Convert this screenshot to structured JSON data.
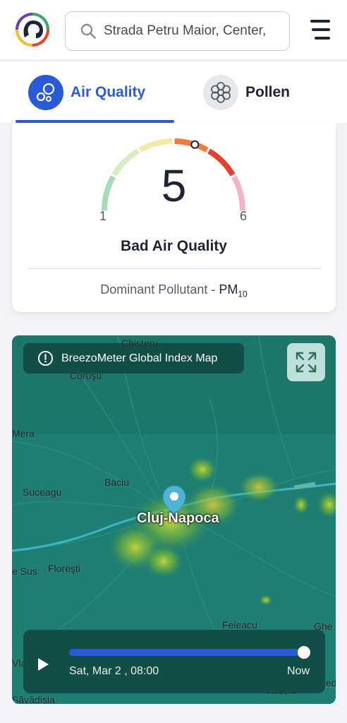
{
  "header": {
    "logo_icon": "breezometer-logo-icon",
    "search": {
      "value": "Strada Petru Maior, Center,",
      "icon": "search-icon"
    },
    "menu_icon": "hamburger-menu-icon"
  },
  "tabs": [
    {
      "label": "Air Quality",
      "icon": "air-bubbles-icon",
      "active": true
    },
    {
      "label": "Pollen",
      "icon": "pollen-flower-icon",
      "active": false
    }
  ],
  "air_quality": {
    "value": "5",
    "scale_min": "1",
    "scale_max": "6",
    "level": 5,
    "label": "Bad Air Quality",
    "dominant_pollutant_prefix": "Dominant Pollutant - ",
    "pollutant_main": "PM",
    "pollutant_sub": "10",
    "colors": [
      "#a8dcb9",
      "#d8ecc2",
      "#f8e9a8",
      "#f07b3e",
      "#e73f2c",
      "#f5b3c7"
    ]
  },
  "map": {
    "title": "BreezoMeter Global Index Map",
    "info_icon": "info-circle-icon",
    "expand_icon": "expand-arrows-icon",
    "city": "Cluj-Napoca",
    "places": [
      "Chisteru",
      "Coruşu",
      "Mera",
      "Baciu",
      "Suceagu",
      "e Sus",
      "Floreşti",
      "Feleacu",
      "Ghe",
      "Vla",
      "Săvădisla",
      "Valcele",
      "ted"
    ],
    "pin_icon": "location-pin-icon",
    "player": {
      "play_icon": "play-icon",
      "time": "Sat, Mar 2 , 08:00",
      "now": "Now",
      "progress": 1.0
    },
    "colors": {
      "background": "#1d7f74",
      "hotspot": "#a8c93b",
      "badge": "#124d47"
    }
  }
}
